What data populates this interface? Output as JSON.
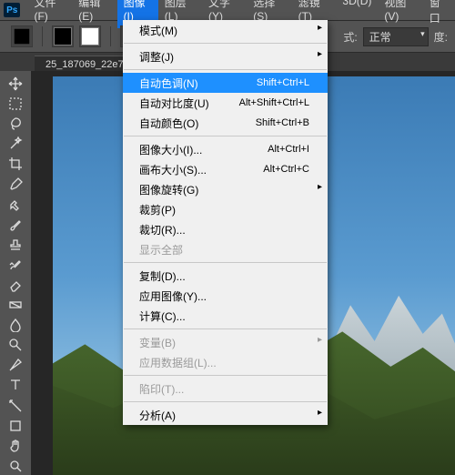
{
  "logo": "Ps",
  "menubar": [
    "文件(F)",
    "编辑(E)",
    "图像(I)",
    "图层(L)",
    "文字(Y)",
    "选择(S)",
    "滤镜(T)",
    "3D(D)",
    "视图(V)",
    "窗口"
  ],
  "openMenuIndex": 2,
  "optionsbar": {
    "modeLabel": "式:",
    "modeValue": "正常",
    "opacityLabel": "度:"
  },
  "docTab": "25_187069_22e72",
  "imageMenu": [
    {
      "label": "模式(M)",
      "submenu": true
    },
    {
      "sep": true
    },
    {
      "label": "调整(J)",
      "submenu": true
    },
    {
      "sep": true
    },
    {
      "label": "自动色调(N)",
      "shortcut": "Shift+Ctrl+L",
      "selected": true
    },
    {
      "label": "自动对比度(U)",
      "shortcut": "Alt+Shift+Ctrl+L"
    },
    {
      "label": "自动颜色(O)",
      "shortcut": "Shift+Ctrl+B"
    },
    {
      "sep": true
    },
    {
      "label": "图像大小(I)...",
      "shortcut": "Alt+Ctrl+I"
    },
    {
      "label": "画布大小(S)...",
      "shortcut": "Alt+Ctrl+C"
    },
    {
      "label": "图像旋转(G)",
      "submenu": true
    },
    {
      "label": "裁剪(P)"
    },
    {
      "label": "裁切(R)..."
    },
    {
      "label": "显示全部",
      "disabled": true
    },
    {
      "sep": true
    },
    {
      "label": "复制(D)..."
    },
    {
      "label": "应用图像(Y)..."
    },
    {
      "label": "计算(C)..."
    },
    {
      "sep": true
    },
    {
      "label": "变量(B)",
      "submenu": true,
      "disabled": true
    },
    {
      "label": "应用数据组(L)...",
      "disabled": true
    },
    {
      "sep": true
    },
    {
      "label": "陷印(T)...",
      "disabled": true
    },
    {
      "sep": true
    },
    {
      "label": "分析(A)",
      "submenu": true
    }
  ],
  "tools": [
    "move",
    "marquee",
    "lasso",
    "wand",
    "crop",
    "eyedrop",
    "heal",
    "brush",
    "stamp",
    "history",
    "eraser",
    "gradient",
    "blur",
    "dodge",
    "pen",
    "type",
    "path",
    "rect",
    "hand",
    "zoom"
  ]
}
